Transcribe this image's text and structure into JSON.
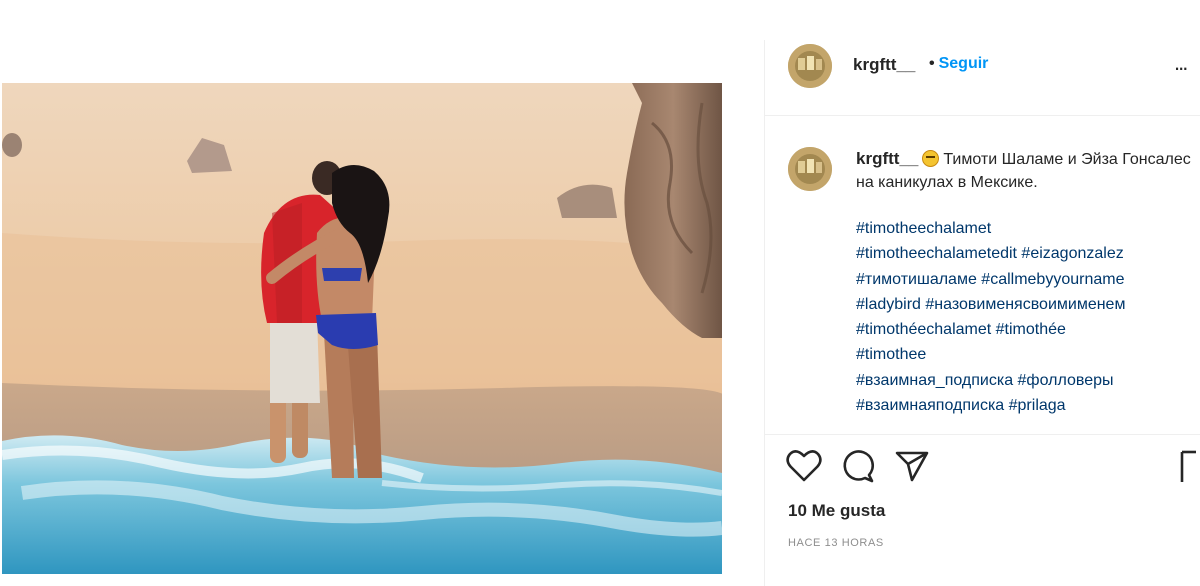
{
  "post": {
    "username": "krgftt__",
    "follow_label": "Seguir",
    "follow_dot": "•",
    "more_label": "...",
    "caption_text": "Тимоти Шаламе и Эйза Гонсалес на каникулах в Мексике.",
    "hashtags": [
      "#timotheechalamet",
      "#timotheechalametedit #eizagonzalez",
      "#тимотишаламе #callmebyyourname",
      "#ladybird #назовименясвоимименем",
      "#timothéechalamet #timothée",
      "#timothee",
      "#взаимная_подписка #фолловеры",
      "#взаимнаяподписка #prilaga"
    ],
    "likes_label": "10 Me gusta",
    "time_label": "HACE 13 HORAS"
  },
  "icons": {
    "like": "heart-icon",
    "comment": "comment-icon",
    "share": "paper-plane-icon",
    "save": "bookmark-icon",
    "caption_emoji": "grimacing-face-emoji"
  },
  "colors": {
    "follow": "#0095f6",
    "hashtag": "#00376b",
    "text": "#262626",
    "muted": "#8e8e8e"
  }
}
